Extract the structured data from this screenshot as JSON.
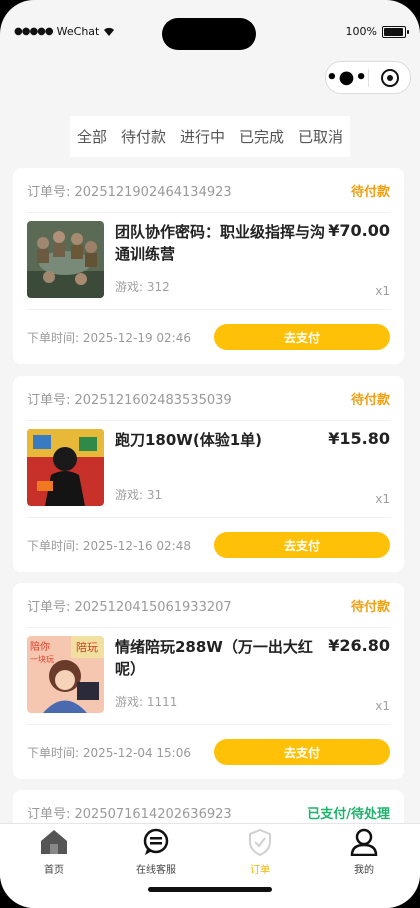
{
  "status_bar": {
    "carrier": "WeChat",
    "battery": "100%"
  },
  "tabs": [
    "全部",
    "待付款",
    "进行中",
    "已完成",
    "已取消"
  ],
  "orders": [
    {
      "order_no": "订单号: 2025121902464134923",
      "status": "待付款",
      "title": "团队协作密码：职业级指挥与沟通训练营",
      "price": "¥70.00",
      "game": "游戏: 312",
      "qty": "x1",
      "time": "下单时间: 2025-12-19 02:46",
      "action": "去支付"
    },
    {
      "order_no": "订单号: 2025121602483535039",
      "status": "待付款",
      "title": "跑刀180W(体验1单)",
      "price": "¥15.80",
      "game": "游戏: 31",
      "qty": "x1",
      "time": "下单时间: 2025-12-16 02:48",
      "action": "去支付"
    },
    {
      "order_no": "订单号: 2025120415061933207",
      "status": "待付款",
      "title": "情绪陪玩288W（万一出大红呢）",
      "price": "¥26.80",
      "game": "游戏: 1111",
      "qty": "x1",
      "time": "下单时间: 2025-12-04 15:06",
      "action": "去支付",
      "thumb_text": [
        "陪你",
        "一块玩",
        "陪玩"
      ]
    },
    {
      "order_no": "订单号: 2025071614202636923",
      "status": "已支付/待处理"
    }
  ],
  "tabbar": [
    "首页",
    "在线客服",
    "订单",
    "我的"
  ],
  "colors": {
    "accent": "#ffc107",
    "pending": "#f0a010",
    "paid": "#1db36a"
  }
}
